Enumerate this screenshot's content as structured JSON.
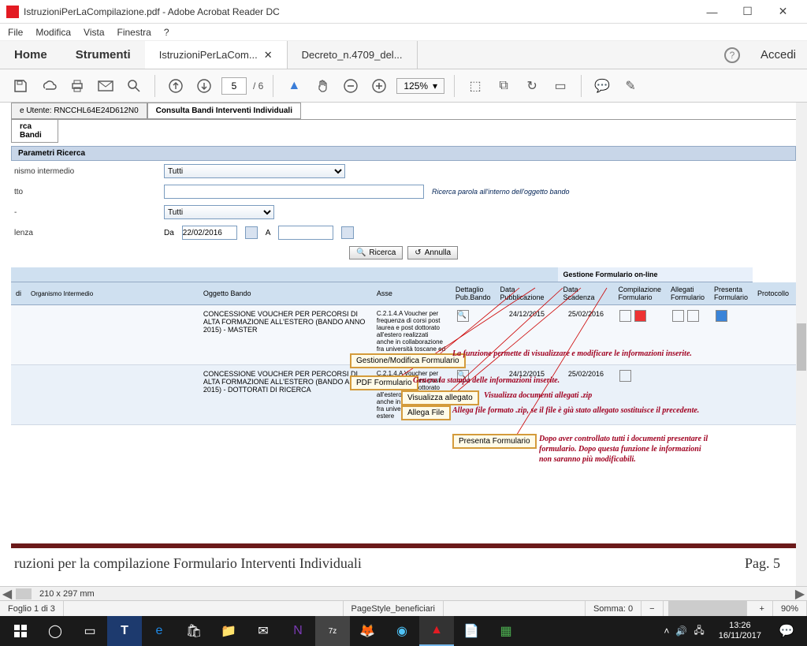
{
  "window": {
    "title": "IstruzioniPerLaCompilazione.pdf - Adobe Acrobat Reader DC"
  },
  "menu": {
    "file": "File",
    "modifica": "Modifica",
    "vista": "Vista",
    "finestra": "Finestra",
    "help": "?"
  },
  "tabs": {
    "home": "Home",
    "tools": "Strumenti",
    "doc1": "IstruzioniPerLaCom...",
    "doc2": "Decreto_n.4709_del...",
    "accedi": "Accedi"
  },
  "toolbar": {
    "page_current": "5",
    "page_total": "/ 6",
    "zoom": "125%"
  },
  "pdf": {
    "crumb1": "e Utente: RNCCHL64E24D612N0",
    "crumb2": "Consulta Bandi Interventi Individuali",
    "crumb3": "rca Bandi",
    "panel_title": "Parametri Ricerca",
    "labels": {
      "organismo": "nismo intermedio",
      "oggetto": "tto",
      "asse": "-",
      "scadenza": "lenza"
    },
    "values": {
      "tutti": "Tutti",
      "oggetto_hint": "Ricerca parola all'interno dell'oggetto bando",
      "da": "Da",
      "data": "22/02/2016",
      "a": "A"
    },
    "buttons": {
      "ricerca": "Ricerca",
      "annulla": "Annulla"
    },
    "table": {
      "group": "Gestione Formulario on-line",
      "h1": "di",
      "h2": "Organismo Intermedio",
      "h3": "Oggetto Bando",
      "h4": "Asse",
      "h5": "Dettaglio Pub.Bando",
      "h6": "Data Pubblicazione",
      "h7": "Data Scadenza",
      "h8": "Compilazione Formulario",
      "h9": "Allegati Formulario",
      "h10": "Presenta Formulario",
      "h11": "Protocollo",
      "rows": [
        {
          "oggetto": "CONCESSIONE VOUCHER PER PERCORSI DI ALTA FORMAZIONE ALL'ESTERO (BANDO ANNO 2015) - MASTER",
          "asse": "C.2.1.4.A Voucher per frequenza di corsi post laurea e post dottorato all'estero realizzati anche in collaborazione fra università toscane ed estere",
          "pub": "24/12/2015",
          "scad": "25/02/2016"
        },
        {
          "oggetto": "CONCESSIONE VOUCHER PER PERCORSI DI ALTA FORMAZIONE ALL'ESTERO (BANDO ANNO 2015) - DOTTORATI DI RICERCA",
          "asse": "C.2.1.4.A Voucher per frequenza di corsi post laurea e post dottorato all'estero realizzati anche in collaborazione fra università toscane ed estere",
          "pub": "24/12/2015",
          "scad": "25/02/2016"
        }
      ]
    },
    "callouts": {
      "c1_label": "Gestione/Modifica Formulario",
      "c1_text": "La funzione permette di visualizzare e modificare le informazioni inserite.",
      "c2_label": "PDF Formulario",
      "c2_text": "Genera la stampa delle informazioni inserite.",
      "c3_label": "Visualizza allegato",
      "c3_text": "Visualizza documenti allegati .zip",
      "c4_label": "Allega File",
      "c4_text": "Allega file formato .zip, se il file è già stato allegato sostituisce il precedente.",
      "c5_label": "Presenta Formulario",
      "c5_text": "Dopo aver controllato tutti i documenti presentare il formulario. Dopo questa funzione le informazioni non saranno più modificabili."
    },
    "footer_text": "ruzioni per la compilazione Formulario Interventi Individuali",
    "footer_pag": "Pag. 5",
    "dim": "210 x 297 mm"
  },
  "status": {
    "foglio": "Foglio 1 di 3",
    "pagestyle": "PageStyle_beneficiari",
    "somma": "Somma: 0",
    "zoom_lbl_minus": "−",
    "zoom_lbl_plus": "+",
    "zoom_pct": "90%"
  },
  "taskbar": {
    "time": "13:26",
    "date": "16/11/2017"
  }
}
